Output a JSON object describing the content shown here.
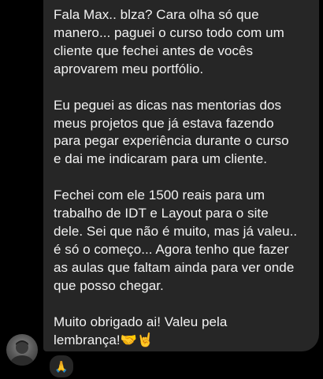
{
  "message": {
    "paragraphs": [
      "Fala Max.. blza? Cara olha só que\nmanero... paguei o curso todo com um\ncliente que fechei antes de vocês\naprovarem meu portfólio.",
      "Eu peguei as dicas nas mentorias dos\nmeus projetos que já estava fazendo\npara pegar experiência durante o curso\ne dai me indicaram para um cliente.",
      "Fechei com ele 1500 reais para um\ntrabalho de IDT e Layout para o site\ndele. Sei que não é muito, mas já valeu..\né só o começo... Agora tenho que fazer\nas aulas que faltam ainda para ver onde\nque posso chegar.",
      "Muito obrigado ai! Valeu pela\nlembrança!🤝🤘"
    ]
  },
  "reaction": {
    "emoji": "🙏"
  },
  "sender": {
    "avatar_icon": "user-avatar-photo"
  },
  "colors": {
    "background": "#000000",
    "bubble": "#262626",
    "text": "#f2f2f2"
  }
}
